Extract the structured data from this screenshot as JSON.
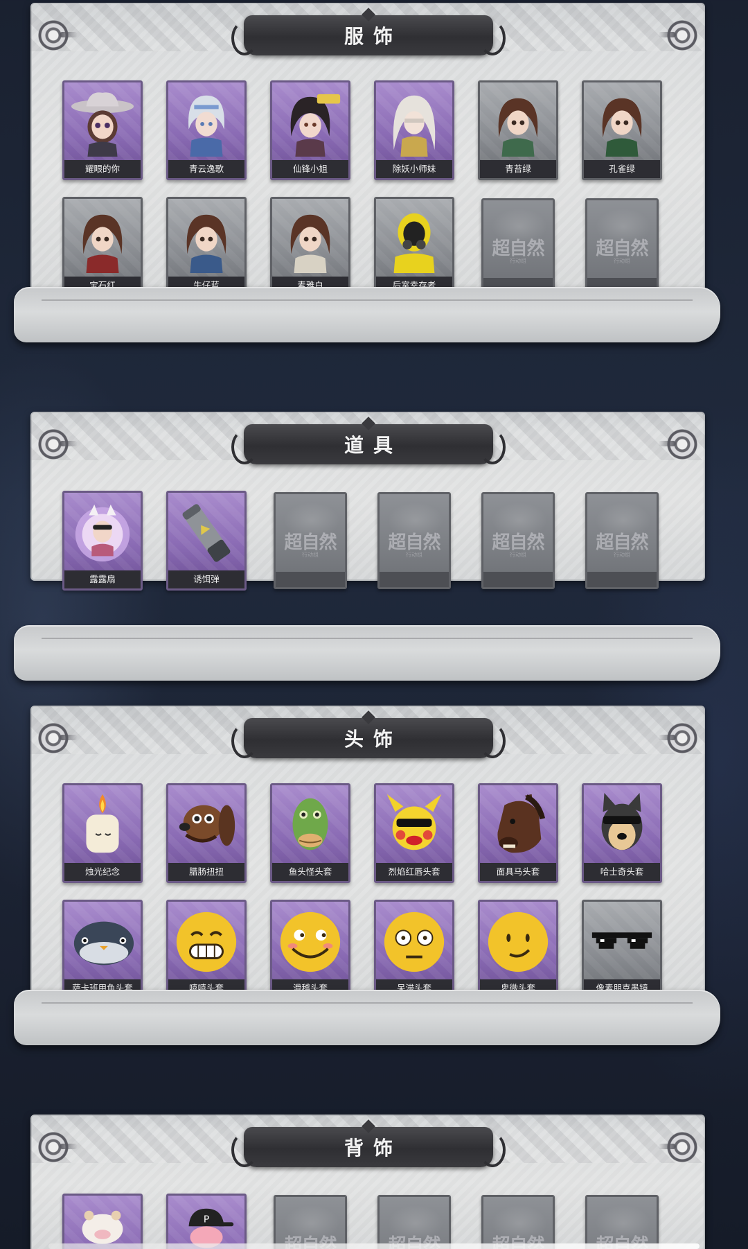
{
  "sections": [
    {
      "title": "服饰",
      "items": [
        {
          "label": "耀眼的你",
          "icon": "girl-cowboy-hat-icon"
        },
        {
          "label": "青云逸歌",
          "icon": "silver-hair-boy-icon"
        },
        {
          "label": "仙锋小姐",
          "icon": "black-hair-girl-icon"
        },
        {
          "label": "除妖小师妹",
          "icon": "white-hair-girl-icon"
        },
        {
          "label": "青苔绿",
          "icon": "brown-hair-girl-icon"
        },
        {
          "label": "孔雀绿",
          "icon": "brown-hair-girl-icon"
        },
        {
          "label": "宝石红",
          "icon": "brown-hair-girl-icon"
        },
        {
          "label": "牛仔蓝",
          "icon": "brown-hair-girl-icon"
        },
        {
          "label": "素雅白",
          "icon": "brown-hair-girl-icon"
        },
        {
          "label": "后室幸存者",
          "icon": "hazmat-suit-icon"
        }
      ],
      "placeholders": 2
    },
    {
      "title": "道具",
      "items": [
        {
          "label": "露露扇",
          "icon": "fan-icon"
        },
        {
          "label": "诱饵弹",
          "icon": "canister-icon"
        }
      ],
      "placeholders": 4
    },
    {
      "title": "头饰",
      "items": [
        {
          "label": "烛光纪念",
          "icon": "candle-head-icon"
        },
        {
          "label": "腊肠扭扭",
          "icon": "dachshund-head-icon"
        },
        {
          "label": "鱼头怪头套",
          "icon": "fish-head-icon"
        },
        {
          "label": "烈焰红唇头套",
          "icon": "pikachu-head-icon"
        },
        {
          "label": "面具马头套",
          "icon": "horse-head-icon"
        },
        {
          "label": "哈士奇头套",
          "icon": "husky-head-icon"
        },
        {
          "label": "萨卡班甲鱼头套",
          "icon": "whale-head-icon"
        },
        {
          "label": "嘻嘻头套",
          "icon": "grin-emoji-icon"
        },
        {
          "label": "滑稽头套",
          "icon": "funny-emoji-icon"
        },
        {
          "label": "呆滞头套",
          "icon": "dazed-emoji-icon"
        },
        {
          "label": "卑微头套",
          "icon": "humble-emoji-icon"
        },
        {
          "label": "像素朋克墨镜",
          "icon": "pixel-sunglasses-icon"
        }
      ],
      "placeholders": 0
    },
    {
      "title": "背饰",
      "items": [
        {
          "label": "",
          "icon": "cow-plush-icon"
        },
        {
          "label": "",
          "icon": "pink-pig-cap-icon"
        }
      ],
      "placeholders": 4
    }
  ],
  "watermark": {
    "main": "超自然",
    "sub": "行动组"
  }
}
